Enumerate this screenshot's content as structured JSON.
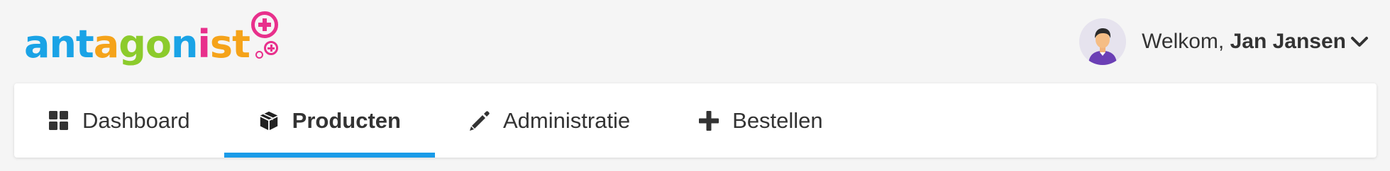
{
  "brand": {
    "logo_letters": [
      "a",
      "n",
      "t",
      "a",
      "g",
      "o",
      "n",
      "i",
      "s",
      "t"
    ],
    "logo_colors": [
      "#1aa3e6",
      "#1aa3e6",
      "#1aa3e6",
      "#f5a31a",
      "#8ccb2c",
      "#8ccb2c",
      "#1aa3e6",
      "#e8308c",
      "#f5a31a",
      "#f5a31a"
    ],
    "accent_color": "#e8308c"
  },
  "user": {
    "greeting": "Welkom, ",
    "name": "Jan Jansen",
    "avatar_icon": "person-avatar-icon",
    "menu_icon": "chevron-down-icon"
  },
  "nav": {
    "active_color": "#1a9be8",
    "items": [
      {
        "label": "Dashboard",
        "icon": "grid-icon",
        "active": false
      },
      {
        "label": "Producten",
        "icon": "box-icon",
        "active": true
      },
      {
        "label": "Administratie",
        "icon": "pencil-icon",
        "active": false
      },
      {
        "label": "Bestellen",
        "icon": "plus-icon",
        "active": false
      }
    ]
  }
}
